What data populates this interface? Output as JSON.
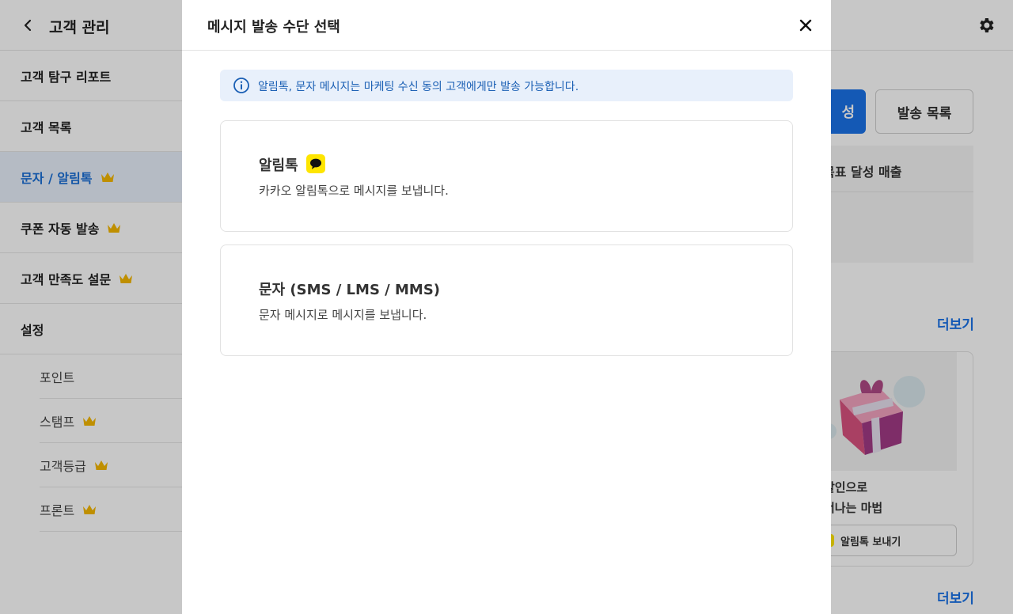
{
  "app": {
    "title": "고객 관리",
    "sidebar": {
      "items": [
        {
          "label": "고객 탐구 리포트",
          "premium": false,
          "active": false
        },
        {
          "label": "고객 목록",
          "premium": false,
          "active": false
        },
        {
          "label": "문자 / 알림톡",
          "premium": true,
          "active": true
        },
        {
          "label": "쿠폰 자동 발송",
          "premium": true,
          "active": false
        },
        {
          "label": "고객 만족도 설문",
          "premium": true,
          "active": false
        },
        {
          "label": "설정",
          "premium": false,
          "active": false
        }
      ],
      "sub_items": [
        {
          "label": "포인트",
          "premium": false
        },
        {
          "label": "스탬프",
          "premium": true
        },
        {
          "label": "고객등급",
          "premium": true
        },
        {
          "label": "프론트",
          "premium": true
        }
      ]
    },
    "right": {
      "primary_button": "성",
      "list_button": "발송 목록",
      "goal_label": "목표 달성 매출",
      "more_link_1": "더보기",
      "promo_line1": "할인으로",
      "promo_line2": "너나는 마법",
      "promo_button": "알림톡 보내기",
      "more_link_2": "더보기"
    }
  },
  "modal": {
    "title": "메시지 발송 수단 선택",
    "info": "알림톡, 문자 메시지는 마케팅 수신 동의 고객에게만 발송 가능합니다.",
    "options": [
      {
        "title": "알림톡",
        "description": "카카오 알림톡으로 메시지를 보냅니다.",
        "icon": "kakao-talk-icon"
      },
      {
        "title": "문자 (SMS / LMS / MMS)",
        "description": "문자 메시지로 메시지를 보냅니다."
      }
    ]
  },
  "colors": {
    "accent": "#1a73e8",
    "active_bg": "#e8f0fb",
    "crown": "#f5b800",
    "kakao": "#fee500"
  }
}
